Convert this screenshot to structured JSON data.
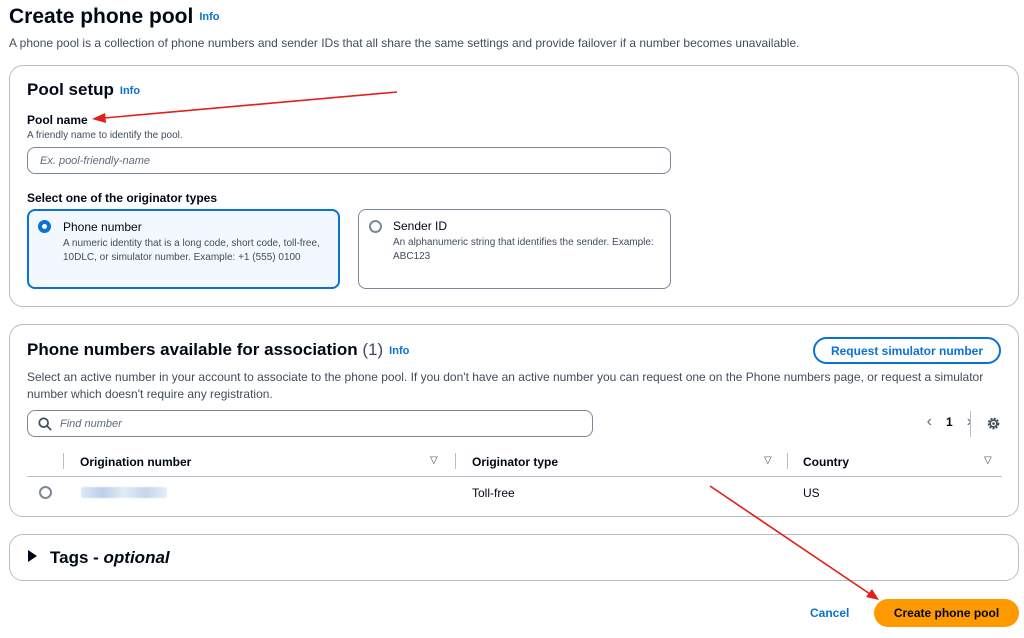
{
  "page": {
    "title": "Create phone pool",
    "info": "Info",
    "description": "A phone pool is a collection of phone numbers and sender IDs that all share the same settings and provide failover if a number becomes unavailable."
  },
  "pool_setup": {
    "heading": "Pool setup",
    "info": "Info",
    "pool_name_label": "Pool name",
    "pool_name_hint": "A friendly name to identify the pool.",
    "pool_name_placeholder": "Ex. pool-friendly-name",
    "pool_name_value": "",
    "originator_label": "Select one of the originator types",
    "originator_options": [
      {
        "title": "Phone number",
        "description": "A numeric identity that is a long code, short code, toll-free, 10DLC, or simulator number. Example: +1 (555) 0100",
        "selected": true
      },
      {
        "title": "Sender ID",
        "description": "An alphanumeric string that identifies the sender. Example: ABC123",
        "selected": false
      }
    ]
  },
  "numbers": {
    "heading": "Phone numbers available for association",
    "count": "(1)",
    "info": "Info",
    "request_button": "Request simulator number",
    "description": "Select an active number in your account to associate to the phone pool. If you don't have an active number you can request one on the Phone numbers page, or request a simulator number which doesn't require any registration.",
    "search_placeholder": "Find number",
    "page": "1",
    "columns": [
      "Origination number",
      "Originator type",
      "Country"
    ],
    "rows": [
      {
        "origination_number_redacted": true,
        "originator_type": "Toll-free",
        "country": "US"
      }
    ]
  },
  "tags": {
    "title": "Tags - ",
    "optional": "optional"
  },
  "footer": {
    "cancel": "Cancel",
    "create": "Create phone pool"
  },
  "colors": {
    "link": "#0972d3",
    "primary_button": "#ff9900",
    "border": "#7d8998",
    "annotation_arrow": "#e0201b"
  }
}
